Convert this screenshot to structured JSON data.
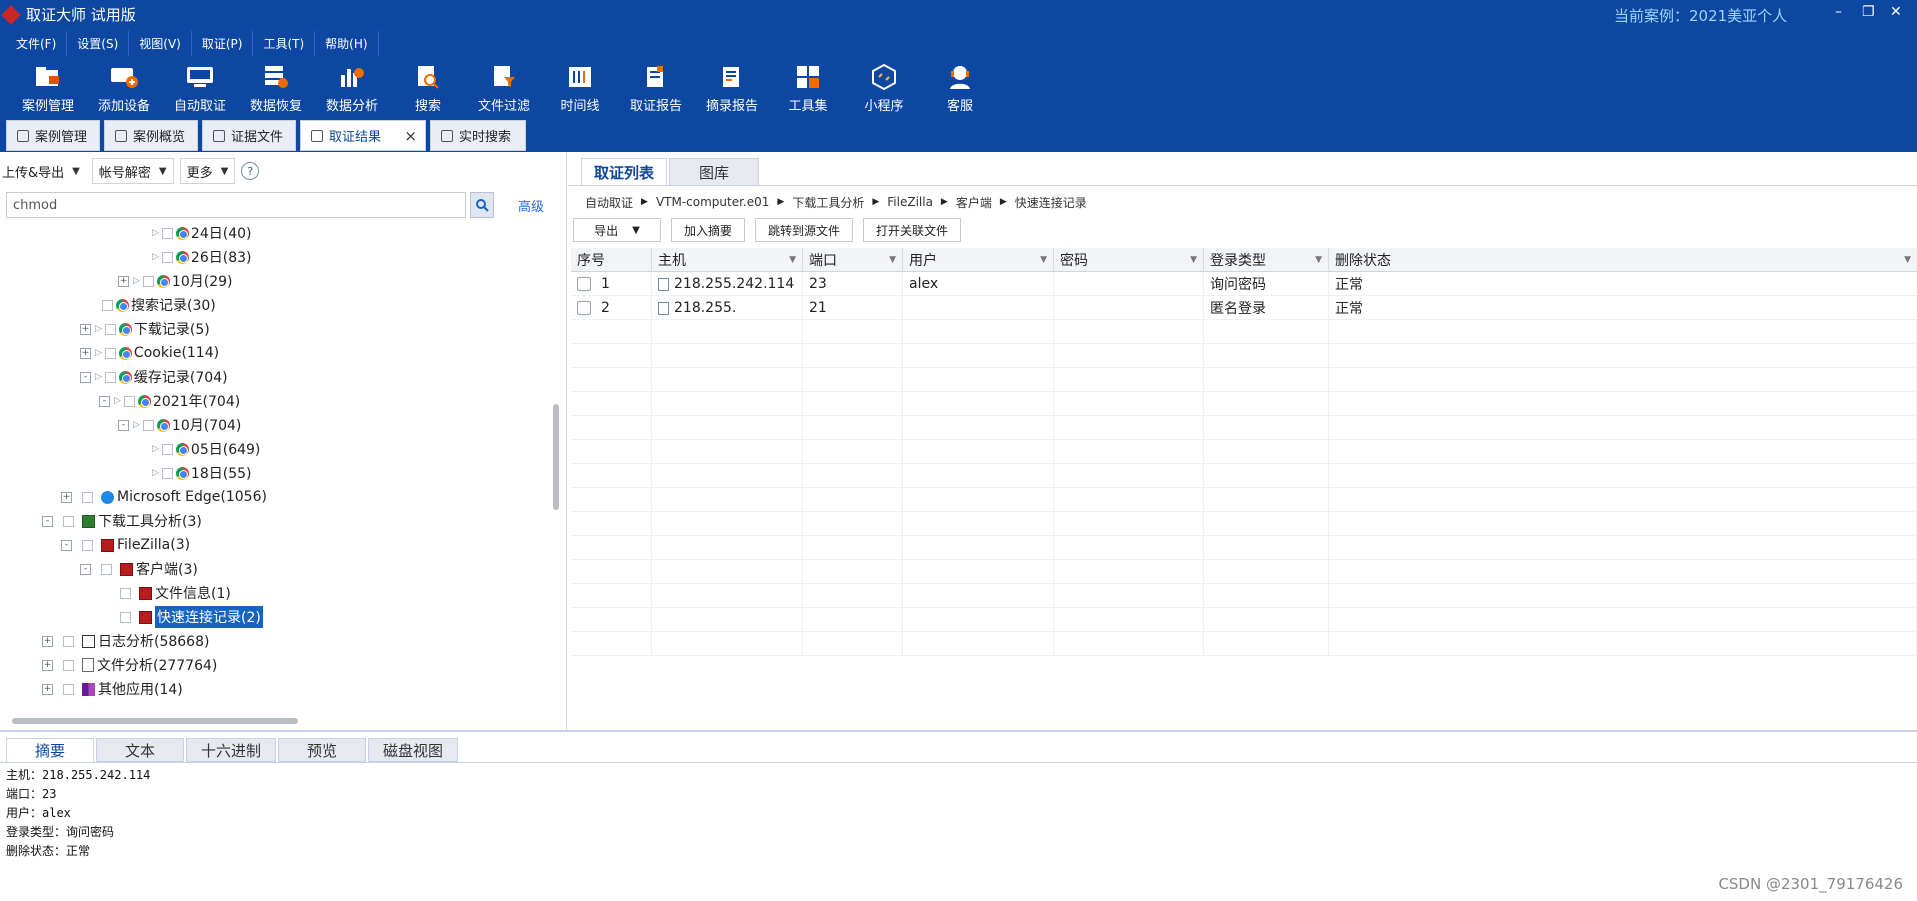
{
  "window": {
    "title": "取证大师 试用版",
    "current_case": "当前案例：2021美亚个人",
    "controls": [
      "–",
      "❐",
      "✕"
    ]
  },
  "menu": [
    "文件(F)",
    "设置(S)",
    "视图(V)",
    "取证(P)",
    "工具(T)",
    "帮助(H)"
  ],
  "toolbar": [
    {
      "label": "案例管理",
      "icon": "folder-icon"
    },
    {
      "label": "添加设备",
      "icon": "add-device-icon"
    },
    {
      "label": "自动取证",
      "icon": "auto-icon"
    },
    {
      "label": "数据恢复",
      "icon": "recover-icon"
    },
    {
      "label": "数据分析",
      "icon": "chart-icon"
    },
    {
      "label": "搜索",
      "icon": "search-doc-icon"
    },
    {
      "label": "文件过滤",
      "icon": "filter-icon"
    },
    {
      "label": "时间线",
      "icon": "timeline-icon"
    },
    {
      "label": "取证报告",
      "icon": "report-icon"
    },
    {
      "label": "摘录报告",
      "icon": "excerpt-icon"
    },
    {
      "label": "工具集",
      "icon": "tools-icon"
    },
    {
      "label": "小程序",
      "icon": "miniapp-icon"
    },
    {
      "label": "客服",
      "icon": "support-icon"
    }
  ],
  "main_tabs": [
    {
      "label": "案例管理"
    },
    {
      "label": "案例概览"
    },
    {
      "label": "证据文件"
    },
    {
      "label": "取证结果",
      "active": true
    },
    {
      "label": "实时搜索"
    }
  ],
  "left": {
    "tools": {
      "upload": "上传&导出",
      "decrypt": "帐号解密",
      "more": "更多",
      "help": "?"
    },
    "search_value": "chmod",
    "advanced": "高级",
    "tree": [
      {
        "label": "24日(40)",
        "icon": "chrome"
      },
      {
        "label": "26日(83)",
        "icon": "chrome"
      },
      {
        "label": "10月(29)",
        "icon": "chrome",
        "toggle": "+"
      },
      {
        "label": "搜索记录(30)",
        "icon": "chrome"
      },
      {
        "label": "下载记录(5)",
        "icon": "chrome",
        "toggle": "+"
      },
      {
        "label": "Cookie(114)",
        "icon": "chrome",
        "toggle": "+"
      },
      {
        "label": "缓存记录(704)",
        "icon": "chrome",
        "toggle": "-"
      },
      {
        "label": "2021年(704)",
        "icon": "chrome",
        "toggle": "-"
      },
      {
        "label": "10月(704)",
        "icon": "chrome",
        "toggle": "-"
      },
      {
        "label": "05日(649)",
        "icon": "chrome"
      },
      {
        "label": "18日(55)",
        "icon": "chrome"
      },
      {
        "label": "Microsoft Edge(1056)",
        "icon": "edge",
        "toggle": "+"
      },
      {
        "label": "下载工具分析(3)",
        "icon": "download",
        "toggle": "-"
      },
      {
        "label": "FileZilla(3)",
        "icon": "filezilla",
        "toggle": "-"
      },
      {
        "label": "客户端(3)",
        "icon": "filezilla",
        "toggle": "-"
      },
      {
        "label": "文件信息(1)",
        "icon": "filezilla"
      },
      {
        "label": "快速连接记录(2)",
        "icon": "filezilla",
        "selected": true
      },
      {
        "label": "日志分析(58668)",
        "icon": "log",
        "toggle": "+"
      },
      {
        "label": "文件分析(277764)",
        "icon": "file",
        "toggle": "+"
      },
      {
        "label": "其他应用(14)",
        "icon": "app",
        "toggle": "+"
      }
    ]
  },
  "right": {
    "tabs": [
      "取证列表",
      "图库"
    ],
    "breadcrumb": [
      "自动取证",
      "VTM-computer.e01",
      "下载工具分析",
      "FileZilla",
      "客户端",
      "快速连接记录"
    ],
    "actions": {
      "export": "导出",
      "add_summary": "加入摘要",
      "jump_source": "跳转到源文件",
      "open_related": "打开关联文件"
    },
    "columns": [
      "序号",
      "主机",
      "端口",
      "用户",
      "密码",
      "登录类型",
      "删除状态"
    ],
    "rows": [
      {
        "no": "1",
        "host": "218.255.242.114",
        "port": "23",
        "user": "alex",
        "password": "",
        "login_type": "询问密码",
        "deleted": "正常"
      },
      {
        "no": "2",
        "host": "218.255.",
        "port": "21",
        "user": "",
        "password": "",
        "login_type": "匿名登录",
        "deleted": "正常"
      }
    ]
  },
  "bottom": {
    "tabs": [
      "摘要",
      "文本",
      "十六进制",
      "预览",
      "磁盘视图"
    ],
    "summary_lines": [
      "主机：218.255.242.114",
      "端口：23",
      "用户：alex",
      "登录类型：询问密码",
      "删除状态：正常"
    ]
  },
  "watermark": "CSDN @2301_79176426",
  "colors": {
    "titlebar": "#0d47a1",
    "accent": "#1565c0",
    "link": "#2a6ad6"
  }
}
